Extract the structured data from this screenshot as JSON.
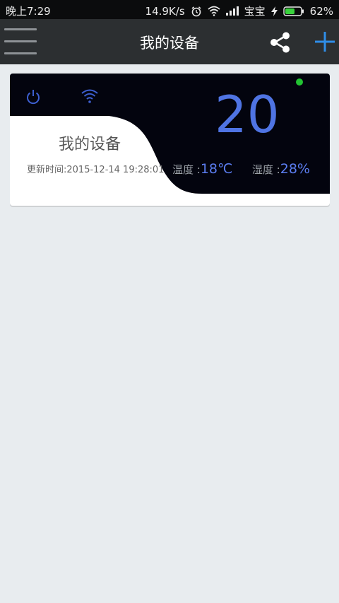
{
  "status_bar": {
    "time": "晚上7:29",
    "net_speed": "14.9K/s",
    "carrier": "宝宝",
    "battery": "62%",
    "battery_level": 0.62,
    "icons": [
      "alarm-icon",
      "wifi-icon",
      "signal-icon",
      "charging-icon",
      "battery-icon"
    ]
  },
  "app_bar": {
    "title": "我的设备",
    "icons": [
      "menu-icon",
      "share-icon",
      "add-icon"
    ],
    "accent_color": "#2f8ee8"
  },
  "device_card": {
    "name": "我的设备",
    "update_time": "更新时间:2015-12-14 19:28:01",
    "set_temp": "20",
    "temperature_label": "温度 :",
    "temperature_value": "18℃",
    "humidity_label": "湿度 :",
    "humidity_value": "28%",
    "online_color": "#22c332",
    "panel_color": "#03040e",
    "accent_color": "#4f74e3",
    "icons": [
      "power-icon",
      "wifi-icon",
      "online-status-dot"
    ]
  }
}
